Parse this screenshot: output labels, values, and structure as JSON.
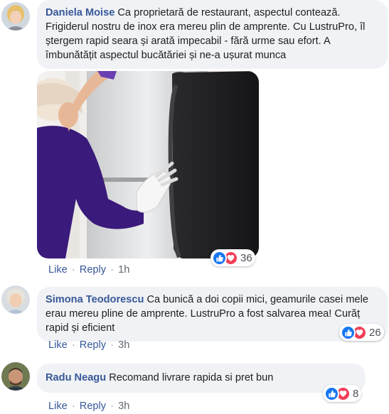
{
  "comments": [
    {
      "author": "Daniela Moise",
      "text": "Ca proprietară de restaurant, aspectul contează. Frigiderul nostru de inox era mereu plin de amprente. Cu LustruPro, îl ștergem rapid seara și arată impecabil - fără urme sau efort. A îmbunătățit aspectul bucătăriei și ne-a ușurat munca",
      "reaction_count": "36",
      "like_label": "Like",
      "reply_label": "Reply",
      "time": "1h"
    },
    {
      "author": "Simona Teodorescu",
      "text": "Ca bunică a doi copii mici, geamurile casei mele erau mereu pline de amprente. LustruPro a fost salvarea mea! Curăț rapid și eficient",
      "reaction_count": "26",
      "like_label": "Like",
      "reply_label": "Reply",
      "time": "3h"
    },
    {
      "author": "Radu Neagu",
      "text": "Recomand livrare rapida si pret bun",
      "reaction_count": "8",
      "like_label": "Like",
      "reply_label": "Reply",
      "time": "3h"
    }
  ],
  "separator": "·",
  "colors": {
    "name": "#385898",
    "bubble": "#f0f2f5",
    "like_blue": "#1877f2",
    "love_red": "#f33e58"
  },
  "icons": [
    "thumbs-up-icon",
    "heart-icon"
  ]
}
